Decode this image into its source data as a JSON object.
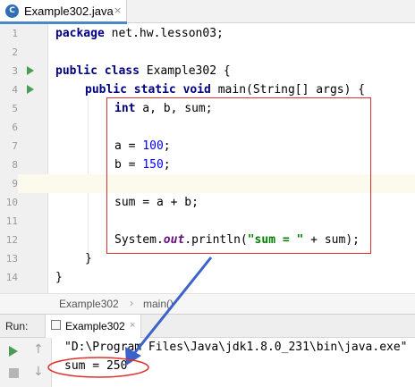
{
  "tab": {
    "filename": "Example302.java",
    "icon": "java-class-icon",
    "close": "×"
  },
  "editor": {
    "lines": [
      {
        "num": "1"
      },
      {
        "num": "2"
      },
      {
        "num": "3"
      },
      {
        "num": "4"
      },
      {
        "num": "5"
      },
      {
        "num": "6"
      },
      {
        "num": "7"
      },
      {
        "num": "8"
      },
      {
        "num": "9"
      },
      {
        "num": "10"
      },
      {
        "num": "11"
      },
      {
        "num": "12"
      },
      {
        "num": "13"
      },
      {
        "num": "14"
      }
    ],
    "code": {
      "l1_kw": "package",
      "l1_rest": " net.hw.lesson03;",
      "l3_kw": "public class",
      "l3_rest": " Example302 {",
      "l4_kw": "public static void",
      "l4_rest": " main(String[] args) {",
      "l5_kw": "int",
      "l5_rest": " a, b, sum;",
      "l7_a": "a = ",
      "l7_num": "100",
      "l7_end": ";",
      "l8_b": "b = ",
      "l8_num": "150",
      "l8_end": ";",
      "l10": "sum = a + b;",
      "l12_sys": "System.",
      "l12_out": "out",
      "l12_mid": ".println(",
      "l12_str": "\"sum = \"",
      "l12_end": " + sum);",
      "l13": "}",
      "l14": "}"
    }
  },
  "breadcrumb": {
    "class_name": "Example302",
    "sep": "›",
    "method": "main()"
  },
  "run_panel": {
    "title": "Run:",
    "tab_label": "Example302",
    "tab_close": "×",
    "console_command": "\"D:\\Program Files\\Java\\jdk1.8.0_231\\bin\\java.exe\"",
    "console_output": "sum = 250"
  },
  "colors": {
    "annotation": "#e0302b",
    "arrow": "#3a62c9",
    "accent": "#4a88c7"
  }
}
